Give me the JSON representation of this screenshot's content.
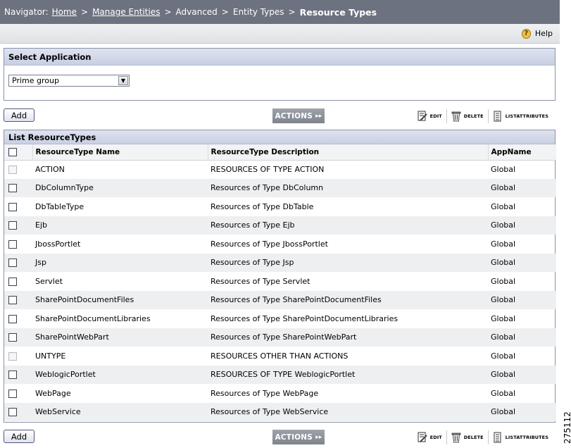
{
  "nav": {
    "prefix": "Navigator:",
    "crumbs": [
      {
        "label": "Home",
        "link": true
      },
      {
        "label": "Manage Entities",
        "link": true
      },
      {
        "label": "Advanced",
        "link": false
      },
      {
        "label": "Entity Types",
        "link": false
      }
    ],
    "separator": ">",
    "current": "Resource Types"
  },
  "help": {
    "label": "Help",
    "icon": "help-question-icon"
  },
  "select_app": {
    "title": "Select Application",
    "selected": "Prime group"
  },
  "toolbar": {
    "add_label": "Add",
    "actions_label": "ACTIONS",
    "edit_label": "EDIT",
    "delete_label": "DELETE",
    "list_attributes_label": "LISTATTRIBUTES"
  },
  "list": {
    "title": "List ResourceTypes",
    "columns": [
      "ResourceType Name",
      "ResourceType Description",
      "AppName"
    ],
    "rows": [
      {
        "name": "ACTION",
        "desc": "RESOURCES OF TYPE ACTION",
        "app": "Global",
        "disabled": true
      },
      {
        "name": "DbColumnType",
        "desc": "Resources of Type DbColumn",
        "app": "Global",
        "disabled": false
      },
      {
        "name": "DbTableType",
        "desc": "Resources of Type DbTable",
        "app": "Global",
        "disabled": false
      },
      {
        "name": "Ejb",
        "desc": "Resources of Type Ejb",
        "app": "Global",
        "disabled": false
      },
      {
        "name": "JbossPortlet",
        "desc": "Resources of Type JbossPortlet",
        "app": "Global",
        "disabled": false
      },
      {
        "name": "Jsp",
        "desc": "Resources of Type Jsp",
        "app": "Global",
        "disabled": false
      },
      {
        "name": "Servlet",
        "desc": "Resources of Type Servlet",
        "app": "Global",
        "disabled": false
      },
      {
        "name": "SharePointDocumentFiles",
        "desc": "Resources of Type SharePointDocumentFiles",
        "app": "Global",
        "disabled": false
      },
      {
        "name": "SharePointDocumentLibraries",
        "desc": "Resources of Type SharePointDocumentLibraries",
        "app": "Global",
        "disabled": false
      },
      {
        "name": "SharePointWebPart",
        "desc": "Resources of Type SharePointWebPart",
        "app": "Global",
        "disabled": false
      },
      {
        "name": "UNTYPE",
        "desc": "RESOURCES OTHER THAN ACTIONS",
        "app": "Global",
        "disabled": true
      },
      {
        "name": "WeblogicPortlet",
        "desc": "RESOURCES OF TYPE WeblogicPortlet",
        "app": "Global",
        "disabled": false
      },
      {
        "name": "WebPage",
        "desc": "Resources of Type WebPage",
        "app": "Global",
        "disabled": false
      },
      {
        "name": "WebService",
        "desc": "Resources of Type WebService",
        "app": "Global",
        "disabled": false
      }
    ]
  },
  "figure_number": "275112"
}
